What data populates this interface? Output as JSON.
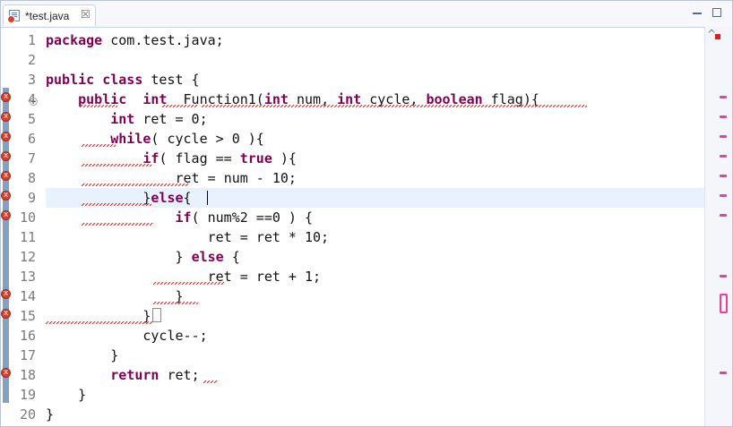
{
  "tab": {
    "title": "*test.java",
    "close": "☒"
  },
  "editor": {
    "lines": [
      {
        "n": "1",
        "code": "package com.test.java;"
      },
      {
        "n": "2",
        "code": ""
      },
      {
        "n": "3",
        "code": "public class test {"
      },
      {
        "n": "4",
        "code": "    public  int  Function1(int num, int cycle, boolean flag){"
      },
      {
        "n": "5",
        "code": "        int ret = 0;"
      },
      {
        "n": "6",
        "code": "        while( cycle > 0 ){"
      },
      {
        "n": "7",
        "code": "            if( flag == true ){"
      },
      {
        "n": "8",
        "code": "                ret = num - 10;"
      },
      {
        "n": "9",
        "code": "            }else{"
      },
      {
        "n": "10",
        "code": "                if( num%2 ==0 ) {"
      },
      {
        "n": "11",
        "code": "                    ret = ret * 10;"
      },
      {
        "n": "12",
        "code": "                } else {"
      },
      {
        "n": "13",
        "code": "                    ret = ret + 1;"
      },
      {
        "n": "14",
        "code": "                }"
      },
      {
        "n": "15",
        "code": "            }"
      },
      {
        "n": "16",
        "code": "            cycle--;"
      },
      {
        "n": "17",
        "code": "        }"
      },
      {
        "n": "18",
        "code": "        return ret;"
      },
      {
        "n": "19",
        "code": "    }"
      },
      {
        "n": "20",
        "code": "}"
      }
    ],
    "keywords": [
      "package",
      "public",
      "class",
      "int",
      "boolean",
      "while",
      "if",
      "true",
      "else",
      "return"
    ]
  },
  "colors": {
    "keyword": "#7f0055",
    "error": "#d6402c",
    "current_line": "#e8f2fe",
    "overview_marker": "#ec3da0"
  }
}
